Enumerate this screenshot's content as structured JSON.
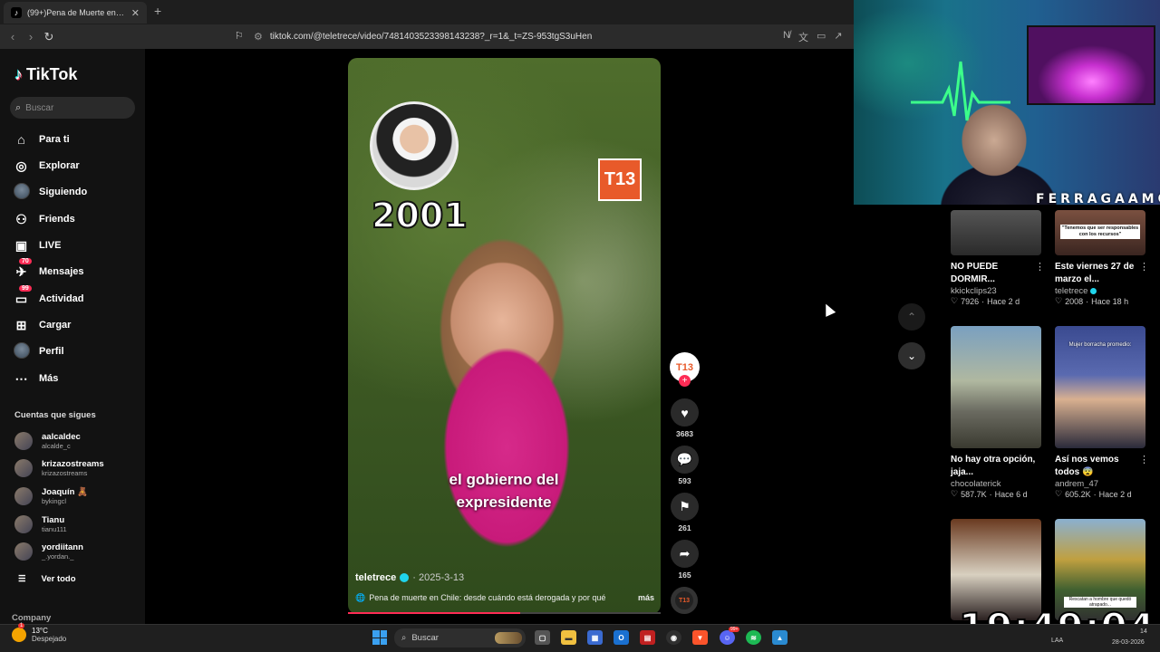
{
  "browser": {
    "tab_title": "(99+)Pena de Muerte en Chile",
    "tab_favicon": "tiktok-icon",
    "new_tab": "+",
    "url": "tiktok.com/@teletrece/video/7481403523398143238?_r=1&_t=ZS-953tgS3uHen"
  },
  "sidebar": {
    "logo_text": "TikTok",
    "search_placeholder": "Buscar",
    "nav": [
      {
        "label": "Para ti",
        "icon": "home-icon"
      },
      {
        "label": "Explorar",
        "icon": "compass-icon"
      },
      {
        "label": "Siguiendo",
        "icon": "following-avatar-icon"
      },
      {
        "label": "Friends",
        "icon": "friends-icon"
      },
      {
        "label": "LIVE",
        "icon": "live-icon"
      },
      {
        "label": "Mensajes",
        "icon": "messages-icon",
        "badge": "70"
      },
      {
        "label": "Actividad",
        "icon": "activity-icon",
        "badge": "99"
      },
      {
        "label": "Cargar",
        "icon": "upload-icon"
      },
      {
        "label": "Perfil",
        "icon": "profile-avatar-icon"
      },
      {
        "label": "Más",
        "icon": "more-icon"
      }
    ],
    "following_header": "Cuentas que sigues",
    "accounts": [
      {
        "name": "aalcaldec",
        "handle": "alcalde_c"
      },
      {
        "name": "krizazostreams",
        "handle": "krizazostreams"
      },
      {
        "name": "Joaquín 🧸",
        "handle": "bykingcl"
      },
      {
        "name": "Tianu",
        "handle": "tianu111"
      },
      {
        "name": "yordiitann",
        "handle": "_.yordan._"
      }
    ],
    "see_all": "Ver todo",
    "company": "Company"
  },
  "video": {
    "overlay_year": "2001",
    "brand_logo": "T13",
    "caption_line1": "el gobierno del",
    "caption_line2": "expresidente",
    "author": "teletrece",
    "date": "· 2025-3-13",
    "description": "Pena de muerte en Chile: desde cuándo está derogada y por qué",
    "more": "más",
    "progress": 0.55
  },
  "actions": {
    "avatar_label": "T13",
    "likes": "3683",
    "comments": "593",
    "saves": "261",
    "shares": "165",
    "music_label": "T13"
  },
  "webcam": {
    "streamer_name": "FERRAGAAMO"
  },
  "feed": [
    {
      "title": "NO PUEDE DORMIR...",
      "user": "kkickclips23",
      "likes": "7926",
      "time": "Hace 2 d",
      "verified": false
    },
    {
      "title": "Este viernes 27 de marzo el...",
      "user": "teletrece",
      "likes": "2008",
      "time": "Hace 18 h",
      "verified": true,
      "thumb_text": "\"Tenemos que ser responsables con los recursos\""
    },
    {
      "title": "No hay otra opción, jaja...",
      "user": "chocolaterick",
      "likes": "587.7K",
      "time": "Hace 6 d",
      "verified": false
    },
    {
      "title": "Así nos vemos todos 😨",
      "user": "andrem_47",
      "likes": "605.2K",
      "time": "Hace 2 d",
      "verified": false,
      "thumb_text": "Mujer borracha promedio:"
    },
    {
      "thumb_text": "Rescatan a hombre que quedó atrapado..."
    }
  ],
  "overlay_clock": "19:49:04",
  "taskbar": {
    "temperature": "13°C",
    "weather": "Despejado",
    "weather_badge": "1",
    "search_label": "Buscar",
    "apps": [
      "file-explorer-icon",
      "store-icon",
      "outlook-icon",
      "news-icon",
      "obs-icon",
      "brave-icon",
      "discord-icon",
      "spotify-icon",
      "photos-icon"
    ],
    "discord_badge": "99+",
    "tray_lang": "LAA",
    "time": "14",
    "date": "28-03-2026"
  },
  "colors": {
    "accent": "#fe2c55",
    "verified": "#20d5ec",
    "t13_orange": "#e85a2a",
    "background": "#000000",
    "sidebar": "#121212"
  }
}
